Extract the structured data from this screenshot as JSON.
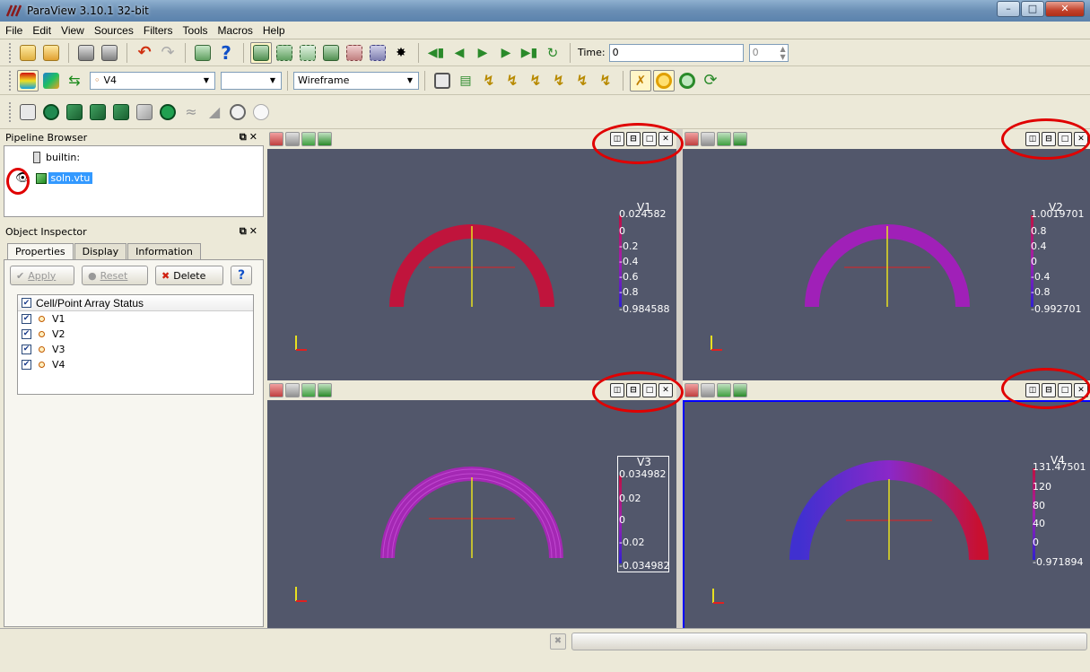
{
  "window": {
    "title": "ParaView 3.10.1 32-bit"
  },
  "menu": [
    "File",
    "Edit",
    "View",
    "Sources",
    "Filters",
    "Tools",
    "Macros",
    "Help"
  ],
  "toolbar": {
    "time_label": "Time:",
    "time_value": "0",
    "timestep_value": "0",
    "array_combo": "V4",
    "component_combo": "",
    "representation_combo": "Wireframe"
  },
  "pipeline_browser": {
    "title": "Pipeline Browser",
    "items": [
      {
        "label": "builtin:"
      },
      {
        "label": "soln.vtu",
        "selected": true,
        "visible": true
      }
    ]
  },
  "object_inspector": {
    "title": "Object Inspector",
    "tabs": [
      "Properties",
      "Display",
      "Information"
    ],
    "active_tab": "Properties",
    "buttons": {
      "apply": "Apply",
      "reset": "Reset",
      "delete": "Delete",
      "help": "?"
    },
    "array_status": {
      "header": "Cell/Point Array Status",
      "arrays": [
        {
          "name": "V1",
          "checked": true
        },
        {
          "name": "V2",
          "checked": true
        },
        {
          "name": "V3",
          "checked": true
        },
        {
          "name": "V4",
          "checked": true
        }
      ]
    }
  },
  "views": [
    {
      "scalar_bar": {
        "title": "V1",
        "labels": [
          "0.024582",
          "0",
          "-0.2",
          "-0.4",
          "-0.6",
          "-0.8",
          "-0.984588"
        ]
      },
      "colors": {
        "ring": "#c0143c"
      },
      "active": false
    },
    {
      "scalar_bar": {
        "title": "V2",
        "labels": [
          "1.0019701",
          "0.8",
          "0.4",
          "0",
          "-0.4",
          "-0.8",
          "-0.992701"
        ]
      },
      "colors": {
        "ring": "#a020b8"
      },
      "active": false
    },
    {
      "scalar_bar": {
        "title": "V3",
        "labels": [
          "0.034982",
          "0.02",
          "0",
          "-0.02",
          "-0.034982"
        ]
      },
      "colors": {
        "ring": "#a428b4"
      },
      "active": false
    },
    {
      "scalar_bar": {
        "title": "V4",
        "labels": [
          "131.47501",
          "120",
          "80",
          "40",
          "0",
          "-0.971894"
        ]
      },
      "colors": {
        "ring_start": "#4030d0",
        "ring_end": "#c81030"
      },
      "active": true
    }
  ],
  "colors": {
    "view_background": "#52576b",
    "active_view_border": "#0000ff",
    "annotation": "#e00000"
  }
}
